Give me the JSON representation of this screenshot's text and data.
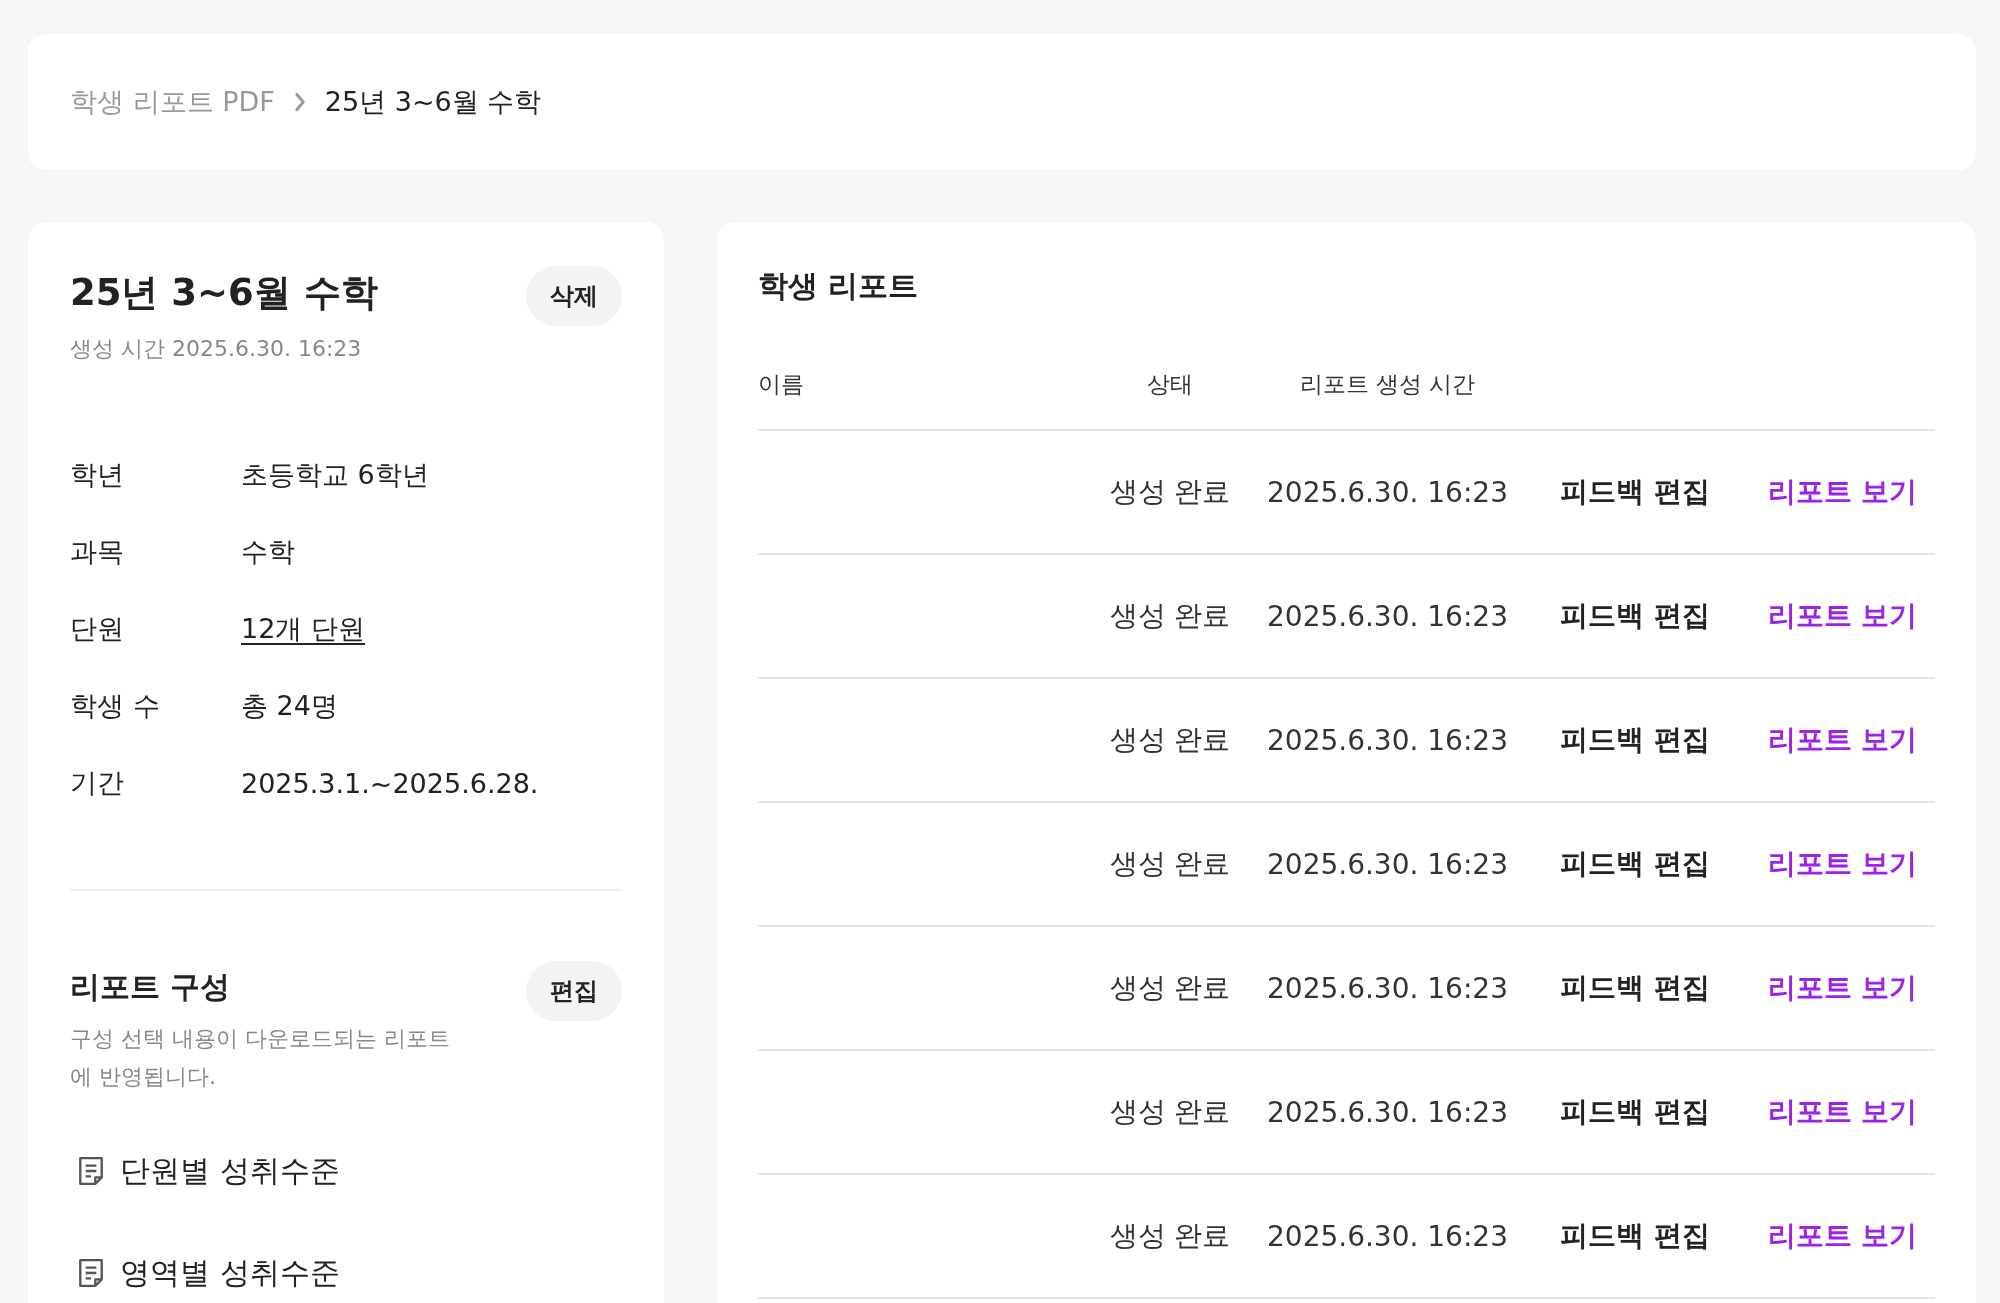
{
  "breadcrumb": [
    {
      "label": "학생 리포트 PDF",
      "current": false
    },
    {
      "label": "25년 3~6월 수학",
      "current": true
    }
  ],
  "detail": {
    "title": "25년 3~6월 수학",
    "created": "생성 시간 2025.6.30. 16:23",
    "delete_button": "삭제",
    "fields": [
      {
        "label": "학년",
        "value": "초등학교 6학년",
        "kind": "text"
      },
      {
        "label": "과목",
        "value": "수학",
        "kind": "text"
      },
      {
        "label": "단원",
        "value": "12개 단원",
        "kind": "link"
      },
      {
        "label": "학생 수",
        "value": "총 24명",
        "kind": "text"
      },
      {
        "label": "기간",
        "value": "2025.3.1.~2025.6.28.",
        "kind": "text"
      }
    ]
  },
  "composition": {
    "title": "리포트 구성",
    "edit_button": "편집",
    "description": "구성 선택 내용이 다운로드되는 리포트에 반영됩니다.",
    "items": [
      "단원별 성취수준",
      "영역별 성취수준"
    ]
  },
  "reports": {
    "title": "학생 리포트",
    "columns": [
      "이름",
      "상태",
      "리포트 생성 시간"
    ],
    "rows": [
      {
        "status": "생성 완료",
        "time": "2025.6.30. 16:23",
        "edit": "피드백 편집",
        "view": "리포트 보기"
      },
      {
        "status": "생성 완료",
        "time": "2025.6.30. 16:23",
        "edit": "피드백 편집",
        "view": "리포트 보기"
      },
      {
        "status": "생성 완료",
        "time": "2025.6.30. 16:23",
        "edit": "피드백 편집",
        "view": "리포트 보기"
      },
      {
        "status": "생성 완료",
        "time": "2025.6.30. 16:23",
        "edit": "피드백 편집",
        "view": "리포트 보기"
      },
      {
        "status": "생성 완료",
        "time": "2025.6.30. 16:23",
        "edit": "피드백 편집",
        "view": "리포트 보기"
      },
      {
        "status": "생성 완료",
        "time": "2025.6.30. 16:23",
        "edit": "피드백 편집",
        "view": "리포트 보기"
      },
      {
        "status": "생성 완료",
        "time": "2025.6.30. 16:23",
        "edit": "피드백 편집",
        "view": "리포트 보기"
      }
    ]
  }
}
